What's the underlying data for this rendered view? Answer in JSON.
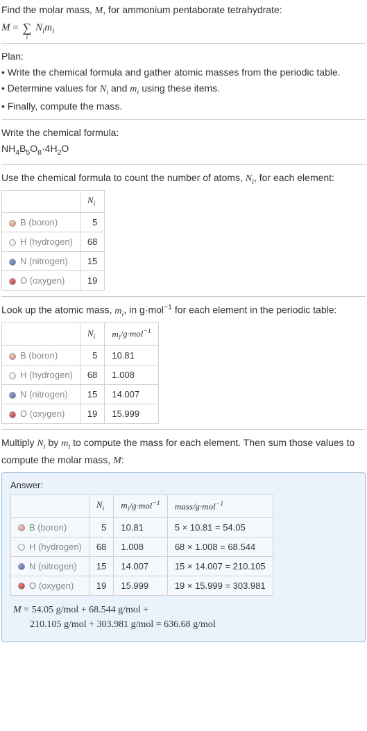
{
  "intro": {
    "line1": "Find the molar mass, M, for ammonium pentaborate tetrahydrate:",
    "formula_prefix": "M = ",
    "formula_sum": "∑",
    "formula_index": "i",
    "formula_rest": " Nᵢmᵢ"
  },
  "plan": {
    "heading": "Plan:",
    "b1": "Write the chemical formula and gather atomic masses from the periodic table.",
    "b2": "Determine values for Nᵢ and mᵢ using these items.",
    "b3": "Finally, compute the mass."
  },
  "chem_formula": {
    "heading": "Write the chemical formula:",
    "formula": "NH₄B₅O₈·4H₂O"
  },
  "count": {
    "heading": "Use the chemical formula to count the number of atoms, Nᵢ, for each element:",
    "col_ni": "Nᵢ",
    "rows": [
      {
        "el_sym": "B",
        "el_name": "(boron)",
        "ni": "5",
        "sw": "sw-b"
      },
      {
        "el_sym": "H",
        "el_name": "(hydrogen)",
        "ni": "68",
        "sw": "sw-h"
      },
      {
        "el_sym": "N",
        "el_name": "(nitrogen)",
        "ni": "15",
        "sw": "sw-n"
      },
      {
        "el_sym": "O",
        "el_name": "(oxygen)",
        "ni": "19",
        "sw": "sw-o"
      }
    ]
  },
  "mass": {
    "heading": "Look up the atomic mass, mᵢ, in g·mol⁻¹ for each element in the periodic table:",
    "col_ni": "Nᵢ",
    "col_mi": "mᵢ/g·mol⁻¹",
    "rows": [
      {
        "el_sym": "B",
        "el_name": "(boron)",
        "ni": "5",
        "mi": "10.81",
        "sw": "sw-b"
      },
      {
        "el_sym": "H",
        "el_name": "(hydrogen)",
        "ni": "68",
        "mi": "1.008",
        "sw": "sw-h"
      },
      {
        "el_sym": "N",
        "el_name": "(nitrogen)",
        "ni": "15",
        "mi": "14.007",
        "sw": "sw-n"
      },
      {
        "el_sym": "O",
        "el_name": "(oxygen)",
        "ni": "19",
        "mi": "15.999",
        "sw": "sw-o"
      }
    ]
  },
  "compute": {
    "heading1": "Multiply Nᵢ by mᵢ to compute the mass for each element. Then sum those values to compute the molar mass, M:",
    "answer_label": "Answer:",
    "col_ni": "Nᵢ",
    "col_mi": "mᵢ/g·mol⁻¹",
    "col_mass": "mass/g·mol⁻¹",
    "rows": [
      {
        "el_sym": "B",
        "el_name": "(boron)",
        "ni": "5",
        "mi": "10.81",
        "mass": "5 × 10.81 = 54.05",
        "sw": "sw-b"
      },
      {
        "el_sym": "H",
        "el_name": "(hydrogen)",
        "ni": "68",
        "mi": "1.008",
        "mass": "68 × 1.008 = 68.544",
        "sw": "sw-h"
      },
      {
        "el_sym": "N",
        "el_name": "(nitrogen)",
        "ni": "15",
        "mi": "14.007",
        "mass": "15 × 14.007 = 210.105",
        "sw": "sw-n"
      },
      {
        "el_sym": "O",
        "el_name": "(oxygen)",
        "ni": "19",
        "mi": "15.999",
        "mass": "19 × 15.999 = 303.981",
        "sw": "sw-o"
      }
    ],
    "final1": "M = 54.05 g/mol + 68.544 g/mol +",
    "final2": "210.105 g/mol + 303.981 g/mol = 636.68 g/mol"
  }
}
